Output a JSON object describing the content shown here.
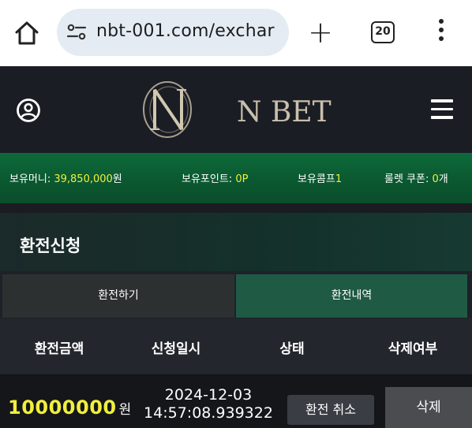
{
  "browser": {
    "url": "nbt-001.com/exchar",
    "tab_count": "20",
    "new_tab_label": "+"
  },
  "header": {
    "logo_text": "N BET"
  },
  "balance": {
    "money_label": "보유머니: ",
    "money_value": "39,850,000",
    "money_unit": "원",
    "points_label": "보유포인트: ",
    "points_value": "0P",
    "comp_label": "보유콤프",
    "comp_value": "1",
    "coupon_label": "룰렛 쿠폰: ",
    "coupon_value": "0",
    "coupon_unit": "개"
  },
  "panel": {
    "title": "환전신청",
    "tabs": [
      {
        "label": "환전하기",
        "active": false
      },
      {
        "label": "환전내역",
        "active": true
      }
    ],
    "columns": [
      "환전금액",
      "신청일시",
      "상태",
      "삭제여부"
    ],
    "rows": [
      {
        "amount": "10000000",
        "unit": "원",
        "date_line1": "2024-12-03",
        "date_line2": "14:57:08.939322",
        "status_button": "환전 취소",
        "delete_button": "삭제"
      }
    ]
  },
  "colors": {
    "accent_yellow": "#f1ef3c",
    "balance_green": "#0b5a31",
    "active_tab": "#1f5a45"
  }
}
